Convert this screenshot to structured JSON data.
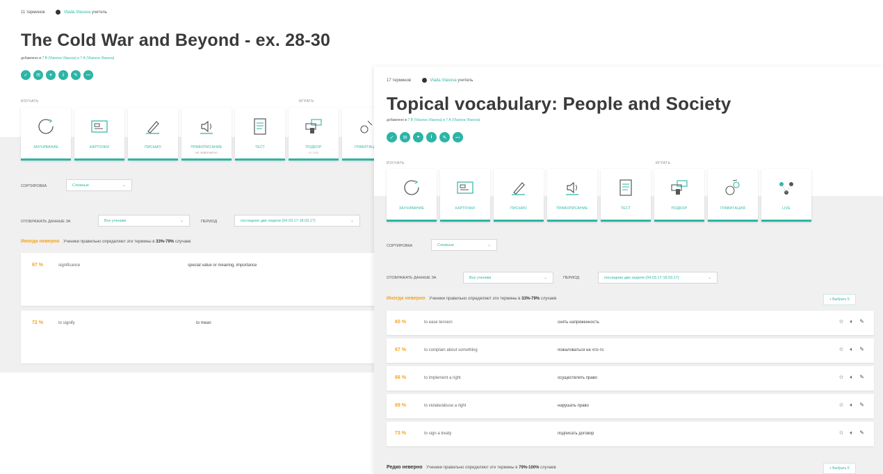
{
  "left": {
    "meta": {
      "count": "11 терминов",
      "author": "Vlada Vlasova",
      "role": "учитель"
    },
    "title": "The Cold War and Beyond - ex. 28-30",
    "added": {
      "prefix": "добавлено в",
      "sets": "7 В (Vlasova Vlasova) и 7 А (Vlasova Vlasova)"
    },
    "circles": [
      "✓",
      "✉",
      "+",
      "i",
      "✎",
      "⋯"
    ],
    "sections": {
      "learn": "ИЗУЧАТЬ",
      "play": "ИГРАТЬ"
    },
    "modes": [
      {
        "label": "ЗАУЧИВАНИЕ",
        "sub": ""
      },
      {
        "label": "КАРТОЧКИ",
        "sub": ""
      },
      {
        "label": "ПИСЬМО",
        "sub": ""
      },
      {
        "label": "ПРАВОПИСАНИЕ",
        "sub": "НЕ ЗАВЕРШЕНО"
      },
      {
        "label": "ТЕСТ",
        "sub": ""
      },
      {
        "label": "ПОДБОР",
        "sub": "0 / 1:02"
      },
      {
        "label": "ГРАВИТАЦИЯ",
        "sub": ""
      }
    ],
    "sort_label": "СОРТИРОВКА",
    "sort_value": "Сложные",
    "report_label": "ОТОБРАЖАТЬ ДАННЫЕ ЗА",
    "report_value": "Все ученики",
    "period_label": "ПЕРИОД",
    "period_value": "последние две недели (04.03.17-18.03.17)",
    "group": {
      "title": "Иногда неверно",
      "desc": "Ученики правильно определяют эти термины в",
      "range": "33%-79%",
      "tail": "случаев"
    },
    "rows": [
      {
        "pct": "67 %",
        "term": "significance",
        "def": "special value or meaning, importance"
      },
      {
        "pct": "72 %",
        "term": "to signify",
        "def": "to mean"
      }
    ]
  },
  "right": {
    "meta": {
      "count": "17 терминов",
      "author": "Vlada Vlasova",
      "role": "учитель"
    },
    "title": "Topical vocabulary: People and Society",
    "added": {
      "prefix": "добавлено в",
      "sets": "7 В (Vlasova Vlasova) и 7 А (Vlasova Vlasova)"
    },
    "circles": [
      "✓",
      "✉",
      "+",
      "i",
      "✎",
      "⋯"
    ],
    "sections": {
      "learn": "ИЗУЧАТЬ",
      "play": "ИГРАТЬ"
    },
    "modes": [
      {
        "label": "ЗАУЧИВАНИЕ",
        "sub": ""
      },
      {
        "label": "КАРТОЧКИ",
        "sub": ""
      },
      {
        "label": "ПИСЬМО",
        "sub": ""
      },
      {
        "label": "ПРАВОПИСАНИЕ",
        "sub": ""
      },
      {
        "label": "ТЕСТ",
        "sub": ""
      },
      {
        "label": "ПОДБОР",
        "sub": ""
      },
      {
        "label": "ГРАВИТАЦИЯ",
        "sub": ""
      },
      {
        "label": "LIVE",
        "sub": ""
      }
    ],
    "sort_label": "СОРТИРОВКА",
    "sort_value": "Сложные",
    "report_label": "ОТОБРАЖАТЬ ДАННЫЕ ЗА",
    "report_value": "Все ученики",
    "period_label": "ПЕРИОД",
    "period_value": "последние две недели (04.03.17-18.03.17)",
    "choose_label": "+ Выбрать 5",
    "group": {
      "title": "Иногда неверно",
      "desc": "Ученики правильно определяют эти термины в",
      "range": "33%-79%",
      "tail": "случаев"
    },
    "rows": [
      {
        "pct": "60 %",
        "term": "to ease tension",
        "def": "снять напряженность"
      },
      {
        "pct": "67 %",
        "term": "to complain about something",
        "def": "пожаловаться на что-то"
      },
      {
        "pct": "66 %",
        "term": "to implement a right",
        "def": "осуществлять право"
      },
      {
        "pct": "69 %",
        "term": "to violate/abuse a right",
        "def": "нарушать право"
      },
      {
        "pct": "73 %",
        "term": "to sign a treaty",
        "def": "подписать договор"
      }
    ],
    "group2": {
      "title": "Редко неверно",
      "desc": "Ученики правильно определяют эти термины в",
      "range": "79%-100%",
      "tail": "случаев"
    },
    "choose_label2": "+ Выбрать 6"
  }
}
